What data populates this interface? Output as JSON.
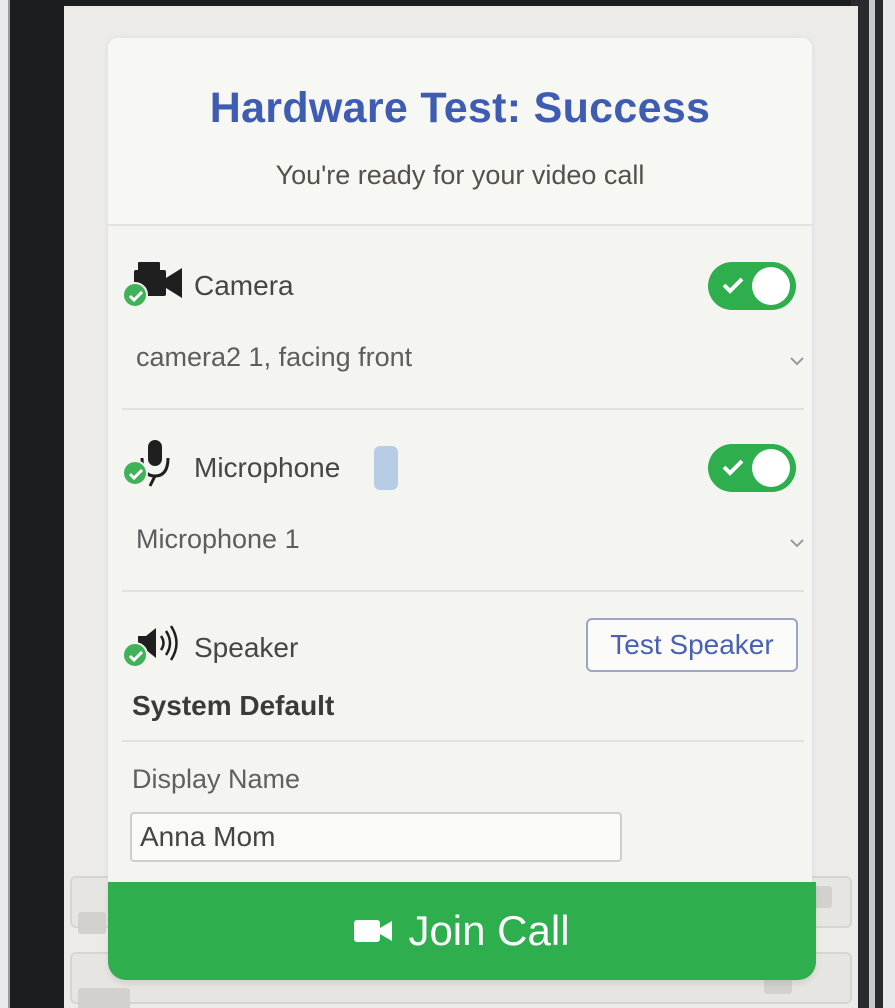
{
  "header": {
    "title": "Hardware Test: Success",
    "subtitle": "You're ready for your video call"
  },
  "camera": {
    "label": "Camera",
    "icon": "video-camera-icon",
    "status": "check-icon",
    "enabled": true,
    "selected_device": "camera2 1, facing front"
  },
  "microphone": {
    "label": "Microphone",
    "icon": "microphone-icon",
    "status": "check-icon",
    "enabled": true,
    "selected_device": "Microphone 1"
  },
  "speaker": {
    "label": "Speaker",
    "icon": "speaker-icon",
    "status": "check-icon",
    "test_button": "Test Speaker",
    "selected_device": "System Default"
  },
  "display_name": {
    "label": "Display Name",
    "value": "Anna Mom"
  },
  "join": {
    "label": "Join Call",
    "icon": "video-camera-icon"
  },
  "colors": {
    "accent_blue": "#3f5cb3",
    "success_green": "#2fae4d"
  }
}
